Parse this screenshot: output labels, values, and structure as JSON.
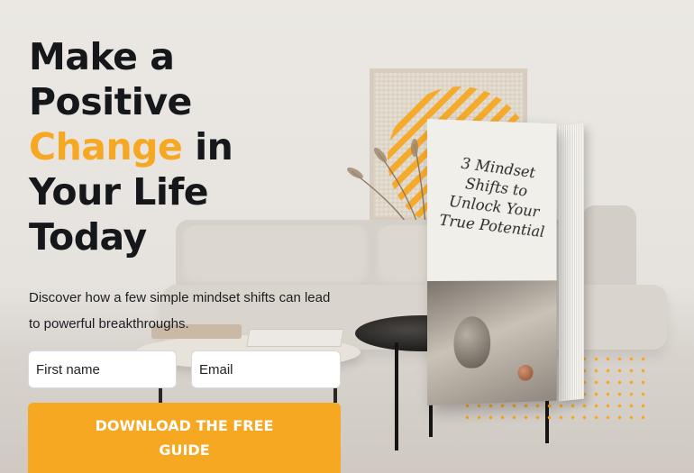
{
  "hero": {
    "headline_pre": "Make a Positive ",
    "headline_highlight": "Change",
    "headline_post": " in Your Life Today",
    "subtext": "Discover how a few simple mindset shifts can lead to powerful breakthroughs."
  },
  "form": {
    "first_name_placeholder": "First name",
    "email_placeholder": "Email",
    "submit_label": "DOWNLOAD THE FREE GUIDE"
  },
  "book": {
    "title": "3 Mindset Shifts to Unlock Your True Potential"
  },
  "colors": {
    "accent": "#f7a823",
    "heading": "#15171b"
  }
}
